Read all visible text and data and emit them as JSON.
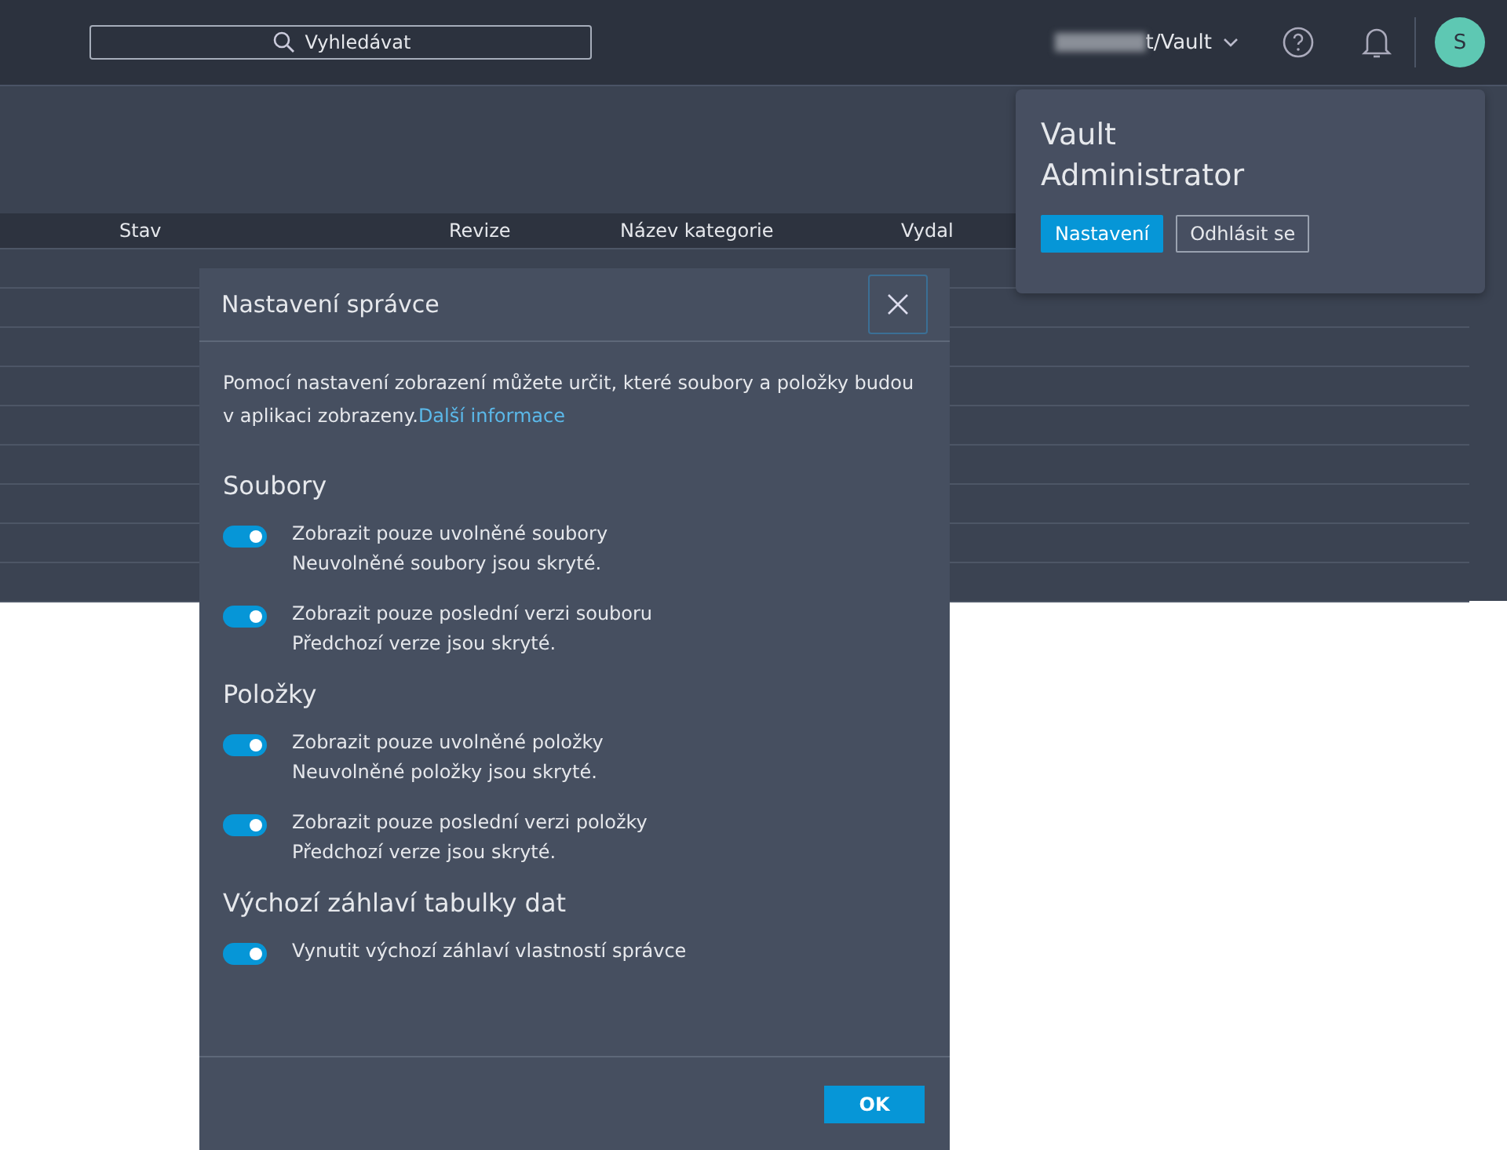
{
  "top_bar": {
    "search": {
      "placeholder": "Vyhledávat"
    },
    "vault_name": "t/Vault"
  },
  "avatar": {
    "initial": "S"
  },
  "table": {
    "columns": [
      "Stav",
      "Revize",
      "Název kategorie",
      "Vydal"
    ]
  },
  "user_menu": {
    "name": "Vault Administrator",
    "buttons": [
      {
        "label": "Nastavení",
        "kind": "primary"
      },
      {
        "label": "Odhlásit se",
        "kind": "secondary"
      }
    ]
  },
  "dialog": {
    "title": "Nastavení správce",
    "intro": "Pomocí nastavení zobrazení můžete určit, které soubory a položky budou v aplikaci zobrazeny.",
    "link": "Další informace",
    "sections": [
      {
        "heading": "Soubory",
        "options": [
          {
            "label": "Zobrazit pouze uvolněné soubory",
            "note": "Neuvolněné soubory jsou skryté.",
            "on": true
          },
          {
            "label": "Zobrazit pouze poslední verzi souboru",
            "note": "Předchozí verze jsou skryté.",
            "on": true
          }
        ]
      },
      {
        "heading": "Položky",
        "options": [
          {
            "label": "Zobrazit pouze uvolněné položky",
            "note": "Neuvolněné položky jsou skryté.",
            "on": true
          },
          {
            "label": "Zobrazit pouze poslední verzi položky",
            "note": "Předchozí verze jsou skryté.",
            "on": true
          }
        ]
      },
      {
        "heading": "Výchozí záhlaví tabulky dat",
        "options": [
          {
            "label": "Vynutit výchozí záhlaví vlastností správce",
            "on": true
          }
        ]
      }
    ],
    "ok": "OK"
  }
}
